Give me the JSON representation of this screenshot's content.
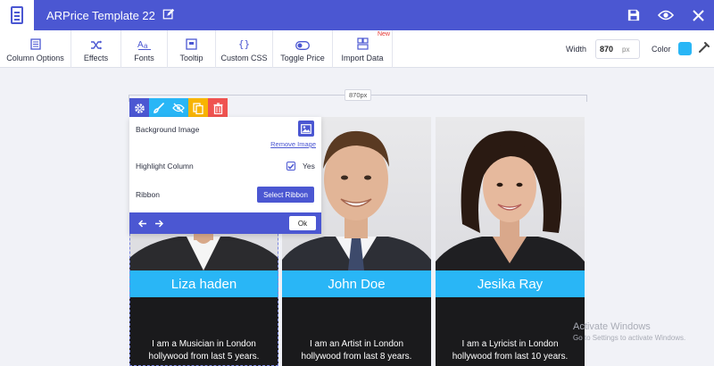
{
  "app": {
    "title": "ARPrice Template 22"
  },
  "toolbar": {
    "items": [
      {
        "label": "Column Options",
        "icon": "column-options-icon"
      },
      {
        "label": "Effects",
        "icon": "shuffle-icon"
      },
      {
        "label": "Fonts",
        "icon": "fonts-icon"
      },
      {
        "label": "Tooltip",
        "icon": "tooltip-icon"
      },
      {
        "label": "Custom CSS",
        "icon": "braces-icon"
      },
      {
        "label": "Toggle Price",
        "icon": "toggle-icon"
      },
      {
        "label": "Import Data",
        "icon": "import-icon"
      }
    ],
    "new_badge": "New",
    "width_label": "Width",
    "width_value": "870",
    "width_unit": "px",
    "color_label": "Color",
    "color_value": "#29b6f6"
  },
  "ruler": {
    "label": "870px"
  },
  "popup": {
    "background_label": "Background Image",
    "remove_image": "Remove Image",
    "highlight_label": "Highlight Column",
    "highlight_checked": true,
    "highlight_value": "Yes",
    "ribbon_label": "Ribbon",
    "ribbon_button": "Select Ribbon",
    "ok_button": "Ok"
  },
  "columns": [
    {
      "name": "Liza haden",
      "desc_line1": "I am a Musician in London",
      "desc_line2": "hollywood from last 5 years."
    },
    {
      "name": "John Doe",
      "desc_line1": "I am an Artist in London",
      "desc_line2": "hollywood from last 8 years."
    },
    {
      "name": "Jesika Ray",
      "desc_line1": "I am a Lyricist in London",
      "desc_line2": "hollywood from last 10 years."
    }
  ],
  "watermark": {
    "line1": "Activate Windows",
    "line2": "Go to Settings to activate Windows."
  },
  "colors": {
    "primary": "#4b57d2",
    "accent": "#29b6f6",
    "dark": "#1a1a1c"
  }
}
